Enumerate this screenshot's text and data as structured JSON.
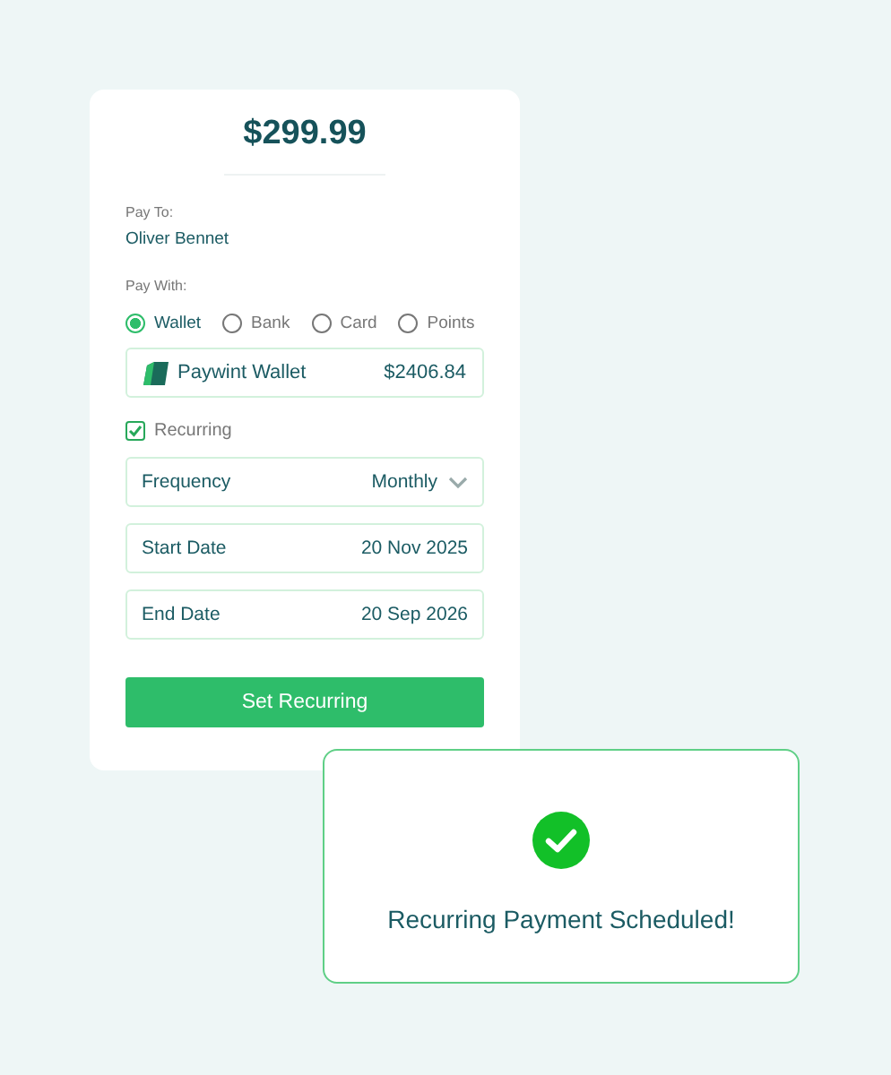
{
  "payment": {
    "amount": "$299.99",
    "pay_to_label": "Pay To:",
    "payee": "Oliver Bennet",
    "pay_with_label": "Pay With:",
    "methods": [
      {
        "label": "Wallet",
        "selected": true
      },
      {
        "label": "Bank",
        "selected": false
      },
      {
        "label": "Card",
        "selected": false
      },
      {
        "label": "Points",
        "selected": false
      }
    ],
    "wallet": {
      "name": "Paywint Wallet",
      "balance": "$2406.84"
    },
    "recurring": {
      "label": "Recurring",
      "checked": true
    },
    "fields": [
      {
        "kind": "select",
        "label": "Frequency",
        "value": "Monthly"
      },
      {
        "kind": "date",
        "label": "Start Date",
        "value": "20 Nov 2025"
      },
      {
        "kind": "date",
        "label": "End Date",
        "value": "20 Sep 2026"
      }
    ],
    "button": "Set Recurring"
  },
  "toast": {
    "message": "Recurring Payment Scheduled!"
  }
}
